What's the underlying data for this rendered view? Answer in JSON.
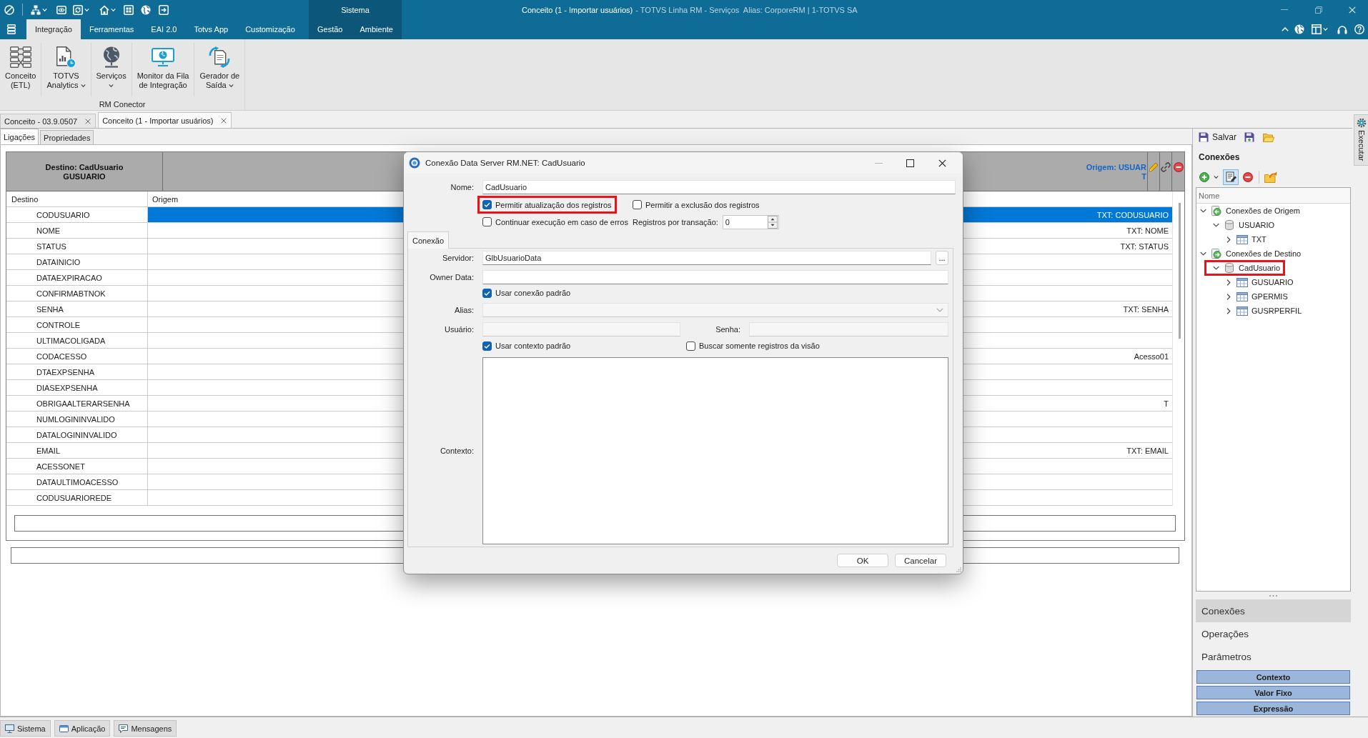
{
  "title_bar": {
    "context_label": "Sistema",
    "title": "Conceito (1 - Importar usuários)",
    "subtitle": "- TOTVS Linha RM - Serviços  Alias: CorporeRM | 1-TOTVS SA"
  },
  "menu_tabs": [
    {
      "label": "Integração",
      "selected": true
    },
    {
      "label": "Ferramentas",
      "selected": false
    },
    {
      "label": "EAI 2.0",
      "selected": false
    },
    {
      "label": "Totvs App",
      "selected": false
    },
    {
      "label": "Customização",
      "selected": false
    }
  ],
  "context_tabs": [
    {
      "label": "Gestão",
      "selected": false
    },
    {
      "label": "Ambiente",
      "selected": false
    }
  ],
  "ribbon": {
    "buttons": [
      {
        "lines": [
          "Conceito",
          "(ETL)"
        ],
        "dropdown": false
      },
      {
        "lines": [
          "TOTVS",
          "Analytics"
        ],
        "dropdown": true
      },
      {
        "lines": [
          "Serviços"
        ],
        "dropdown": true
      },
      {
        "lines": [
          "Monitor da Fila",
          "de Integração"
        ],
        "dropdown": false
      },
      {
        "lines": [
          "Gerador de",
          "Saída"
        ],
        "dropdown": true
      }
    ],
    "group_label": "RM Conector"
  },
  "doc_tabs": [
    {
      "label": "Conceito - 03.9.0507",
      "selected": false
    },
    {
      "label": "Conceito (1 - Importar usuários)",
      "selected": true
    }
  ],
  "view_tabs": [
    {
      "label": "Ligações",
      "selected": true
    },
    {
      "label": "Propriedades",
      "selected": false
    }
  ],
  "mapping": {
    "destination_header": [
      "Destino: CadUsuario",
      "GUSUARIO"
    ],
    "origin_header": [
      "Origem: USUAR",
      "T"
    ],
    "columns": [
      "Destino",
      "Origem"
    ],
    "rows": [
      {
        "destino": "CODUSUARIO",
        "origem": "TXT: CODUSUARIO",
        "selected": true
      },
      {
        "destino": "NOME",
        "origem": "TXT: NOME",
        "selected": false
      },
      {
        "destino": "STATUS",
        "origem": "TXT: STATUS",
        "selected": false
      },
      {
        "destino": "DATAINICIO",
        "selected": false
      },
      {
        "destino": "DATAEXPIRACAO",
        "selected": false
      },
      {
        "destino": "CONFIRMABTNOK",
        "selected": false
      },
      {
        "destino": "SENHA",
        "origem": "TXT: SENHA",
        "selected": false
      },
      {
        "destino": "CONTROLE",
        "selected": false
      },
      {
        "destino": "ULTIMACOLIGADA",
        "selected": false
      },
      {
        "destino": "CODACESSO",
        "origem": "Acesso01",
        "selected": false
      },
      {
        "destino": "DTAEXPSENHA",
        "selected": false
      },
      {
        "destino": "DIASEXPSENHA",
        "selected": false
      },
      {
        "destino": "OBRIGAALTERARSENHA",
        "origem": "T",
        "selected": false
      },
      {
        "destino": "NUMLOGININVALIDO",
        "selected": false
      },
      {
        "destino": "DATALOGININVALIDO",
        "selected": false
      },
      {
        "destino": "EMAIL",
        "origem": "TXT: EMAIL",
        "selected": false
      },
      {
        "destino": "ACESSONET",
        "selected": false
      },
      {
        "destino": "DATAULTIMOACESSO",
        "selected": false
      },
      {
        "destino": "CODUSUARIOREDE",
        "selected": false
      }
    ]
  },
  "dialog": {
    "title": "Conexão Data Server RM.NET: CadUsuario",
    "name": {
      "label": "Nome:",
      "value": "CadUsuario"
    },
    "options": [
      {
        "label": "Permitir atualização dos registros",
        "checked": true,
        "highlighted": true
      },
      {
        "label": "Permitir a exclusão dos registros",
        "checked": false,
        "highlighted": false
      },
      {
        "label": "Continuar execução em caso de erros",
        "checked": false,
        "highlighted": false
      }
    ],
    "batch": {
      "label": "Registros por transação:",
      "value": "0"
    },
    "tabs": [
      {
        "label": "Conexão",
        "selected": true
      }
    ],
    "server": {
      "label": "Servidor:",
      "value": "GlbUsuarioData",
      "button": "..."
    },
    "owner": {
      "label": "Owner Data:",
      "disabled": false
    },
    "use_default_connection": {
      "label": "Usar conexão padrão",
      "checked": true
    },
    "alias": {
      "label": "Alias:",
      "disabled": true
    },
    "user": {
      "label": "Usuário:",
      "disabled": true
    },
    "password": {
      "label": "Senha:",
      "disabled": true
    },
    "use_default_context": {
      "label": "Usar contexto padrão",
      "checked": true
    },
    "view_only": {
      "label": "Buscar somente registros da visão",
      "checked": false
    },
    "context": {
      "label": "Contexto:"
    },
    "buttons": [
      "OK",
      "Cancelar"
    ]
  },
  "connections_panel": {
    "save_label": "Salvar",
    "title": "Conexões",
    "edit_active": true,
    "tree_header": "Nome",
    "tree": [
      {
        "label": "Conexões de Origem",
        "kind": "source",
        "expanded": true,
        "highlighted": false,
        "children": [
          {
            "label": "USUARIO",
            "kind": "database",
            "expanded": true,
            "highlighted": false,
            "children": [
              {
                "label": "TXT",
                "kind": "table",
                "expanded": false,
                "highlighted": false
              }
            ]
          }
        ]
      },
      {
        "label": "Conexões de Destino",
        "kind": "target",
        "expanded": true,
        "highlighted": false,
        "children": [
          {
            "label": "CadUsuario",
            "kind": "database",
            "expanded": true,
            "highlighted": true,
            "children": [
              {
                "label": "GUSUARIO",
                "kind": "table",
                "expanded": false,
                "highlighted": false
              },
              {
                "label": "GPERMIS",
                "kind": "table",
                "expanded": false,
                "highlighted": false
              },
              {
                "label": "GUSRPERFIL",
                "kind": "table",
                "expanded": false,
                "highlighted": false
              }
            ]
          }
        ]
      }
    ],
    "sections": [
      {
        "label": "Conexões",
        "selected": true
      },
      {
        "label": "Operações",
        "selected": false
      },
      {
        "label": "Parâmetros",
        "selected": false
      }
    ],
    "value_buttons": [
      "Contexto",
      "Valor Fixo",
      "Expressão"
    ]
  },
  "side_tab": "Executar",
  "status_tabs": [
    "Sistema",
    "Aplicação",
    "Mensagens"
  ]
}
